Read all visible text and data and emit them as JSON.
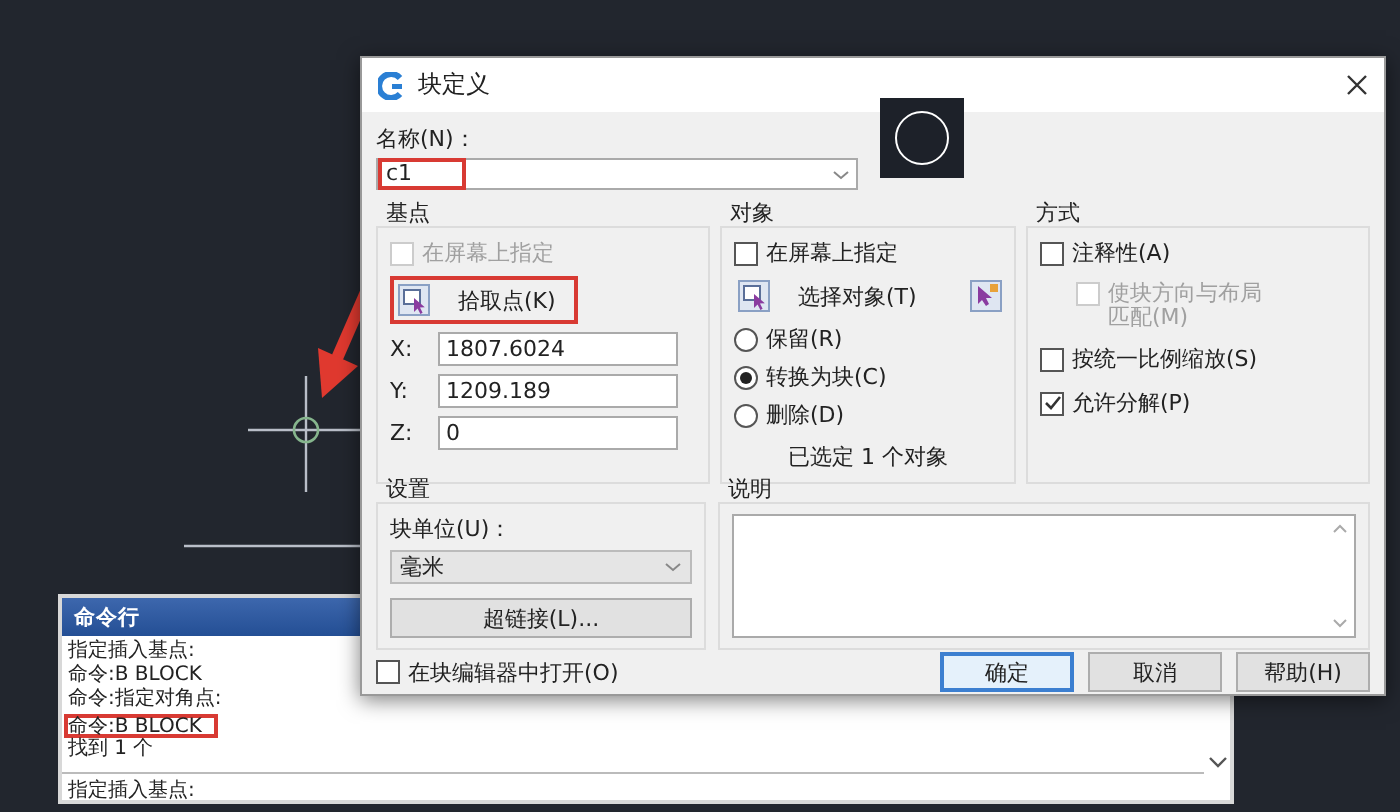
{
  "command_window": {
    "title": "命令行",
    "lines": [
      {
        "text": "指定插入基点:",
        "highlighted": false
      },
      {
        "text": "命令:B BLOCK",
        "highlighted": false
      },
      {
        "text": "命令:指定对角点:",
        "highlighted": false
      },
      {
        "text": "命令:B BLOCK",
        "highlighted": true
      },
      {
        "text": "找到 1 个",
        "highlighted": false
      }
    ],
    "prompt": "指定插入基点:"
  },
  "dialog": {
    "title": "块定义",
    "name_label": "名称(N)：",
    "name_value": "c1",
    "name_highlighted": true,
    "base_point": {
      "title": "基点",
      "specify_on_screen": {
        "label": "在屏幕上指定",
        "checked": false,
        "disabled": true
      },
      "pick_button": {
        "label": "拾取点(K)",
        "highlighted": true
      },
      "coords": [
        {
          "label": "X:",
          "value": "1807.6024"
        },
        {
          "label": "Y:",
          "value": "1209.189"
        },
        {
          "label": "Z:",
          "value": "0"
        }
      ]
    },
    "objects": {
      "title": "对象",
      "specify_on_screen": {
        "label": "在屏幕上指定",
        "checked": false,
        "disabled": false
      },
      "select_button": "选择对象(T)",
      "options": [
        {
          "label": "保留(R)",
          "selected": false
        },
        {
          "label": "转换为块(C)",
          "selected": true
        },
        {
          "label": "删除(D)",
          "selected": false
        }
      ],
      "status": "已选定 1 个对象"
    },
    "behavior": {
      "title": "方式",
      "options": [
        {
          "label": "注释性(A)",
          "checked": false,
          "disabled": false,
          "children": [
            {
              "label": "使块方向与布局匹配(M)",
              "checked": false,
              "disabled": true
            }
          ]
        },
        {
          "label": "按统一比例缩放(S)",
          "checked": false,
          "disabled": false
        },
        {
          "label": "允许分解(P)",
          "checked": true,
          "disabled": false
        }
      ]
    },
    "settings": {
      "title": "设置",
      "unit_label": "块单位(U)：",
      "unit_value": "毫米",
      "hyperlink_button": "超链接(L)..."
    },
    "description": {
      "title": "说明"
    },
    "open_in_editor": {
      "label": "在块编辑器中打开(O)",
      "checked": false
    },
    "buttons": [
      {
        "label": "确定",
        "default": true
      },
      {
        "label": "取消",
        "default": false
      },
      {
        "label": "帮助(H)",
        "default": false
      }
    ]
  }
}
